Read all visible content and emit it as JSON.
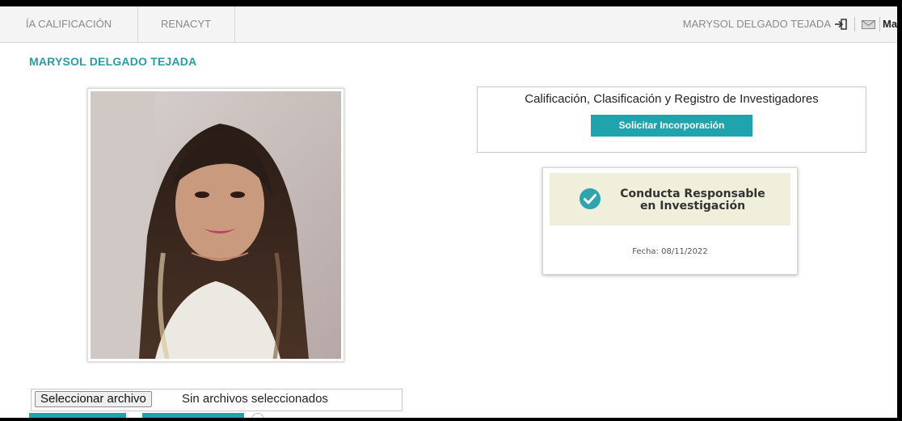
{
  "nav": {
    "tabs": [
      {
        "label": "ÍA CALIFICACIÓN"
      },
      {
        "label": "RENACYT"
      }
    ],
    "user_name": "MARYSOL DELGADO TEJADA",
    "cut_label": "Ma"
  },
  "profile": {
    "name": "MARYSOL DELGADO TEJADA"
  },
  "calificacion": {
    "title": "Calificación, Clasificación y Registro de Investigadores",
    "button_label": "Solicitar Incorporación"
  },
  "badge": {
    "line1": "Conducta Responsable",
    "line2": "en Investigación",
    "date": "Fecha: 08/11/2022"
  },
  "file_upload": {
    "button_label": "Seleccionar archivo",
    "status": "Sin archivos seleccionados"
  },
  "colors": {
    "accent": "#1fa3ad",
    "title": "#2a9aa3",
    "badge_bg": "#efefdc"
  },
  "icons": [
    "logout-icon",
    "mail-icon",
    "check-circle-icon",
    "help-icon"
  ]
}
